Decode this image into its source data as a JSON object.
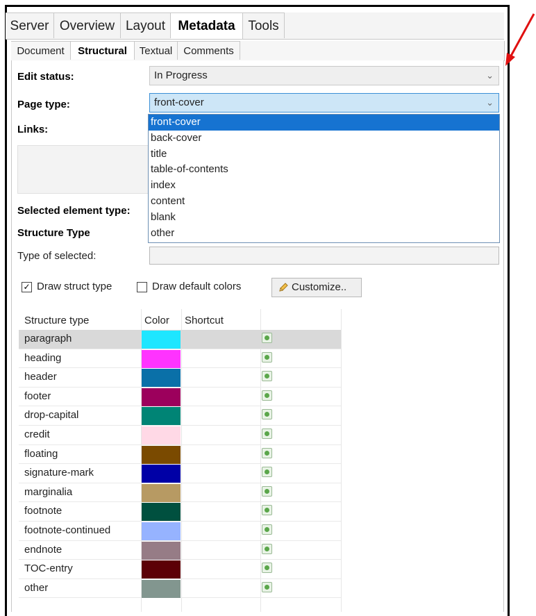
{
  "top_tabs": [
    {
      "label": "Server"
    },
    {
      "label": "Overview"
    },
    {
      "label": "Layout"
    },
    {
      "label": "Metadata",
      "active": true
    },
    {
      "label": "Tools"
    }
  ],
  "sub_tabs": [
    {
      "label": "Document"
    },
    {
      "label": "Structural",
      "active": true
    },
    {
      "label": "Textual"
    },
    {
      "label": "Comments"
    }
  ],
  "edit_status": {
    "label": "Edit status:",
    "value": "In Progress"
  },
  "page_type": {
    "label": "Page type:",
    "value": "front-cover",
    "options": [
      "front-cover",
      "back-cover",
      "title",
      "table-of-contents",
      "index",
      "content",
      "blank",
      "other"
    ],
    "selected_index": 0
  },
  "links": {
    "label": "Links:"
  },
  "selected_element_type": {
    "label": "Selected element type:"
  },
  "structure_type_heading": "Structure Type",
  "type_of_selected": {
    "label": "Type of selected:",
    "value": ""
  },
  "options": {
    "draw_struct_type": {
      "label": "Draw struct type",
      "checked": true
    },
    "draw_default_colors": {
      "label": "Draw default colors",
      "checked": false
    },
    "customize_label": "Customize.."
  },
  "table": {
    "columns": [
      "Structure type",
      "Color",
      "Shortcut"
    ],
    "rows": [
      {
        "name": "paragraph",
        "color": "#1ee6ff",
        "shortcut": "",
        "highlighted": true
      },
      {
        "name": "heading",
        "color": "#ff33ff",
        "shortcut": ""
      },
      {
        "name": "header",
        "color": "#0a70a8",
        "shortcut": ""
      },
      {
        "name": "footer",
        "color": "#9c005c",
        "shortcut": ""
      },
      {
        "name": "drop-capital",
        "color": "#008475",
        "shortcut": ""
      },
      {
        "name": "credit",
        "color": "#ffd9e6",
        "shortcut": ""
      },
      {
        "name": "floating",
        "color": "#7a4a00",
        "shortcut": ""
      },
      {
        "name": "signature-mark",
        "color": "#0000a6",
        "shortcut": ""
      },
      {
        "name": "marginalia",
        "color": "#b79a63",
        "shortcut": ""
      },
      {
        "name": "footnote",
        "color": "#00503f",
        "shortcut": ""
      },
      {
        "name": "footnote-continued",
        "color": "#96b3ff",
        "shortcut": ""
      },
      {
        "name": "endnote",
        "color": "#967c86",
        "shortcut": ""
      },
      {
        "name": "TOC-entry",
        "color": "#5c0006",
        "shortcut": ""
      },
      {
        "name": "other",
        "color": "#82968f",
        "shortcut": ""
      }
    ]
  },
  "annotation_arrow_color": "#e01010"
}
